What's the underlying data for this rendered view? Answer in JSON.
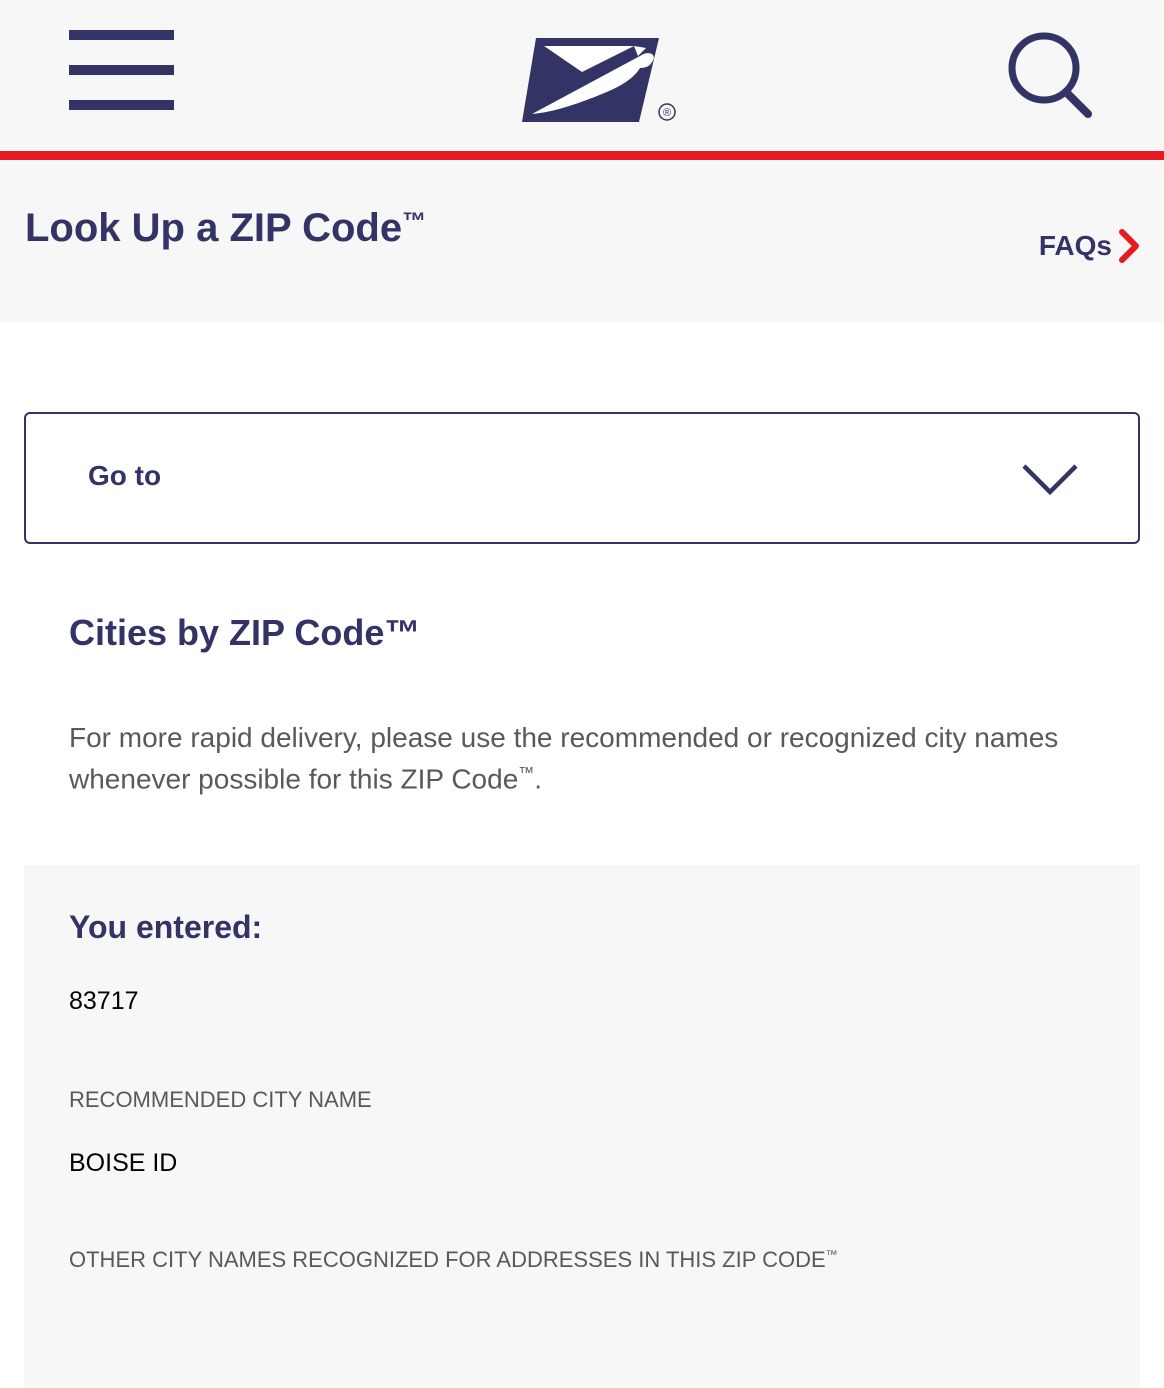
{
  "header": {
    "menu_icon": "hamburger-menu-icon",
    "logo_icon": "usps-eagle-logo",
    "registered_mark": "®",
    "search_icon": "search-icon"
  },
  "colors": {
    "navy": "#333366",
    "red": "#e71921",
    "light_gray": "#f7f7f7",
    "body_gray": "#595959"
  },
  "page": {
    "title": "Look Up a ZIP Code",
    "title_tm": "™",
    "faqs_label": "FAQs",
    "faqs_icon": "chevron-right-icon"
  },
  "goto": {
    "label": "Go to",
    "icon": "chevron-down-icon"
  },
  "cities": {
    "title": "Cities by ZIP Code™",
    "intro_text": "For more rapid delivery, please use the recommended or recognized city names whenever possible for this ZIP Code",
    "intro_tm": "™",
    "intro_end": "."
  },
  "result": {
    "you_entered_label": "You entered:",
    "entered_value": "83717",
    "recommended_label": "RECOMMENDED CITY NAME",
    "recommended_value": "BOISE ID",
    "other_label": "OTHER CITY NAMES RECOGNIZED FOR ADDRESSES IN THIS ZIP CODE",
    "other_tm": "™"
  }
}
